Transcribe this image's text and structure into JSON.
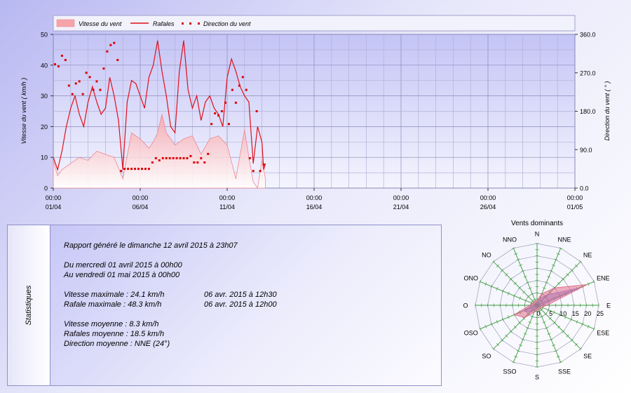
{
  "chart_data": [
    {
      "type": "line",
      "legend": [
        "Vitesse du vent",
        "Rafales",
        "Direction du vent"
      ],
      "legend_position": "top",
      "ylabel": "Vitesse du vent ( km/h )",
      "y2label": "Direction du vent ( ° )",
      "ylim": [
        0,
        50
      ],
      "y2lim": [
        0,
        360
      ],
      "yticks": [
        "0",
        "10",
        "20",
        "30",
        "40",
        "50"
      ],
      "y2ticks": [
        "0.0",
        "90.0",
        "180.0",
        "270.0",
        "360.0"
      ],
      "xlim_days": [
        0,
        30
      ],
      "xticks": [
        {
          "time": "00:00",
          "date": "01/04"
        },
        {
          "time": "00:00",
          "date": "06/04"
        },
        {
          "time": "00:00",
          "date": "11/04"
        },
        {
          "time": "00:00",
          "date": "16/04"
        },
        {
          "time": "00:00",
          "date": "21/04"
        },
        {
          "time": "00:00",
          "date": "26/04"
        },
        {
          "time": "00:00",
          "date": "01/05"
        }
      ],
      "grid": true,
      "colors": {
        "speed_fill": "#f5a5aa",
        "gust_line": "#e0101a",
        "direction_marker": "#dd0000"
      },
      "series": [
        {
          "name": "Vitesse du vent",
          "type": "area",
          "axis": "left",
          "x": [
            0.0,
            0.25,
            0.5,
            1.0,
            1.5,
            2.0,
            2.5,
            3.0,
            3.5,
            4.0,
            4.5,
            5.0,
            5.5,
            5.75,
            6.0,
            6.25,
            6.5,
            7.0,
            7.5,
            8.0,
            8.5,
            9.0,
            9.5,
            10.0,
            10.5,
            11.0,
            11.25,
            11.5,
            11.75,
            12.0,
            12.2
          ],
          "y": [
            9,
            4,
            6,
            8,
            10,
            9,
            12,
            11,
            10,
            3,
            18,
            16,
            13,
            15,
            18,
            24,
            18,
            14,
            16,
            17,
            11,
            16,
            17,
            14,
            3,
            19,
            10,
            2,
            0,
            9,
            3
          ]
        },
        {
          "name": "Rafales",
          "type": "line",
          "axis": "left",
          "x": [
            0.0,
            0.25,
            0.5,
            0.75,
            1.0,
            1.25,
            1.5,
            1.75,
            2.0,
            2.25,
            2.5,
            2.75,
            3.0,
            3.25,
            3.5,
            3.75,
            4.0,
            4.25,
            4.5,
            4.75,
            5.0,
            5.25,
            5.5,
            5.75,
            6.0,
            6.25,
            6.5,
            6.75,
            7.0,
            7.25,
            7.5,
            7.75,
            8.0,
            8.25,
            8.5,
            8.75,
            9.0,
            9.25,
            9.5,
            9.75,
            10.0,
            10.25,
            10.5,
            10.75,
            11.0,
            11.25,
            11.5,
            11.75,
            12.0,
            12.1,
            12.2
          ],
          "y": [
            10,
            6,
            12,
            20,
            26,
            30,
            24,
            20,
            28,
            33,
            28,
            24,
            26,
            36,
            30,
            22,
            6,
            28,
            35,
            34,
            30,
            26,
            36,
            40,
            48,
            38,
            30,
            20,
            18,
            38,
            48,
            32,
            26,
            30,
            22,
            28,
            30,
            26,
            24,
            20,
            36,
            42,
            38,
            33,
            30,
            28,
            8,
            20,
            15,
            6,
            8
          ]
        },
        {
          "name": "Direction du vent",
          "type": "scatter",
          "axis": "right",
          "x": [
            0.1,
            0.3,
            0.5,
            0.7,
            0.9,
            1.1,
            1.3,
            1.5,
            1.7,
            1.9,
            2.1,
            2.3,
            2.5,
            2.7,
            2.9,
            3.1,
            3.3,
            3.5,
            3.7,
            3.9,
            4.1,
            4.3,
            4.5,
            4.7,
            4.9,
            5.1,
            5.3,
            5.5,
            5.7,
            5.9,
            6.1,
            6.3,
            6.5,
            6.7,
            6.9,
            7.1,
            7.3,
            7.5,
            7.7,
            7.9,
            8.1,
            8.3,
            8.5,
            8.7,
            8.9,
            9.1,
            9.3,
            9.5,
            9.7,
            9.9,
            10.1,
            10.3,
            10.5,
            10.7,
            10.9,
            11.1,
            11.3,
            11.5,
            11.7,
            11.9,
            12.1
          ],
          "y": [
            290,
            285,
            310,
            300,
            240,
            220,
            245,
            250,
            220,
            270,
            260,
            230,
            250,
            230,
            280,
            320,
            335,
            340,
            300,
            40,
            45,
            45,
            45,
            45,
            45,
            45,
            45,
            45,
            60,
            70,
            65,
            70,
            70,
            70,
            70,
            70,
            70,
            70,
            70,
            75,
            60,
            60,
            70,
            60,
            80,
            150,
            175,
            170,
            180,
            200,
            150,
            230,
            200,
            240,
            260,
            230,
            70,
            40,
            180,
            40,
            55
          ]
        }
      ]
    },
    {
      "type": "radar",
      "title": "Vents dominants",
      "directions": [
        "N",
        "NNE",
        "NE",
        "ENE",
        "E",
        "ESE",
        "SE",
        "SSE",
        "S",
        "SSO",
        "SO",
        "OSO",
        "O",
        "ONO",
        "NO",
        "NNO"
      ],
      "radial_ticks": [
        "0",
        "5",
        "10",
        "15",
        "20",
        "25"
      ],
      "rmax": 25,
      "colors": {
        "speed": "#8080e0",
        "gust": "#e06080",
        "spokes": "#3c9a3c"
      },
      "series": [
        {
          "name": "Vitesse",
          "values": [
            1,
            3,
            6,
            18,
            2,
            1,
            1,
            1,
            1,
            2,
            4,
            6,
            2,
            1,
            1,
            1
          ]
        },
        {
          "name": "Rafales",
          "values": [
            2,
            5,
            10,
            22,
            4,
            2,
            2,
            2,
            2,
            3,
            7,
            10,
            3,
            2,
            2,
            2
          ]
        }
      ]
    }
  ],
  "stats": {
    "section_label": "Statistiques",
    "report_line": "Rapport généré le dimanche 12 avril 2015 à 23h07",
    "period_from": "Du mercredi 01 avril 2015 à 00h00",
    "period_to": "Au vendredi 01 mai 2015 à 00h00",
    "max_speed": "Vitesse maximale : 24.1 km/h",
    "max_speed_date": "06 avr. 2015 à 12h30",
    "max_gust": "Rafale maximale : 48.3 km/h",
    "max_gust_date": "06 avr. 2015 à 12h00",
    "avg_speed": "Vitesse moyenne : 8.3 km/h",
    "avg_gust": "Rafales moyenne : 18.5 km/h",
    "avg_direction": "Direction moyenne : NNE (24°)"
  }
}
